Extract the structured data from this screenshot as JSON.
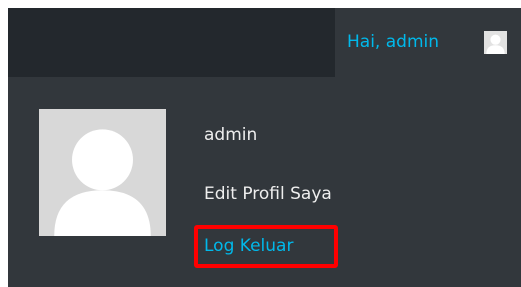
{
  "admin_bar": {
    "greeting": "Hai, admin",
    "avatar_icon": "user-avatar-icon"
  },
  "profile_menu": {
    "avatar_icon": "user-avatar-icon",
    "username": "admin",
    "edit_profile": "Edit Profil Saya",
    "logout": "Log Keluar"
  },
  "colors": {
    "admin_bar_bg": "#23282d",
    "submenu_bg": "#32373c",
    "link": "#00b9eb",
    "text": "#eeeeee",
    "highlight": "#ff0000"
  }
}
